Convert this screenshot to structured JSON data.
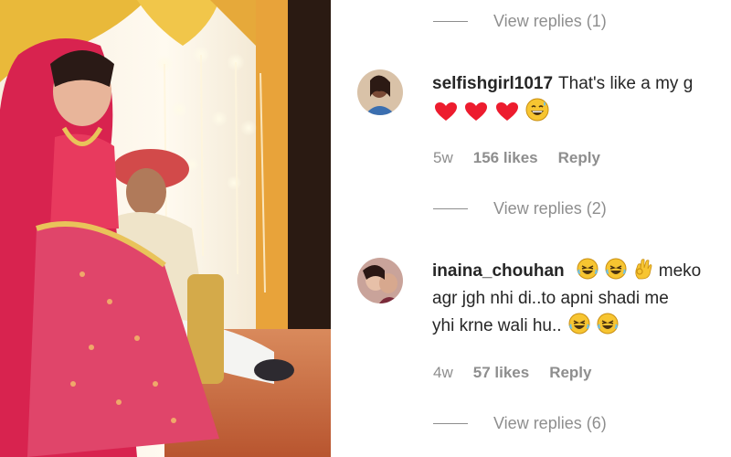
{
  "comments": [
    {
      "username": "selfishgirl1017",
      "text": "That's like a my g",
      "emojis": [
        "red-heart-icon",
        "red-heart-icon",
        "red-heart-icon",
        "grinning-sweat-face-icon"
      ],
      "time": "5w",
      "likes": "156 likes",
      "reply_label": "Reply",
      "view_replies_label": "View replies",
      "view_replies_count": "(2)"
    },
    {
      "username": "inaina_chouhan",
      "emojis_inline": [
        "rolling-laughing-face-icon",
        "rolling-laughing-face-icon",
        "ok-hand-icon"
      ],
      "text_line1_after_emojis": "meko",
      "text_line2": "agr jgh nhi di..to apni shadi me",
      "text_line3": "yhi krne wali hu..",
      "emojis_end": [
        "rolling-laughing-face-icon",
        "rolling-laughing-face-icon"
      ],
      "time": "4w",
      "likes": "57 likes",
      "reply_label": "Reply",
      "view_replies_label": "View replies",
      "view_replies_count": "(6)"
    }
  ],
  "top_view_replies": {
    "label": "View replies",
    "count": "(1)"
  },
  "colors": {
    "text": "#262626",
    "secondary": "#8e8e8e",
    "heart": "#ed1c2e",
    "bride_saree": "#d8234f"
  }
}
